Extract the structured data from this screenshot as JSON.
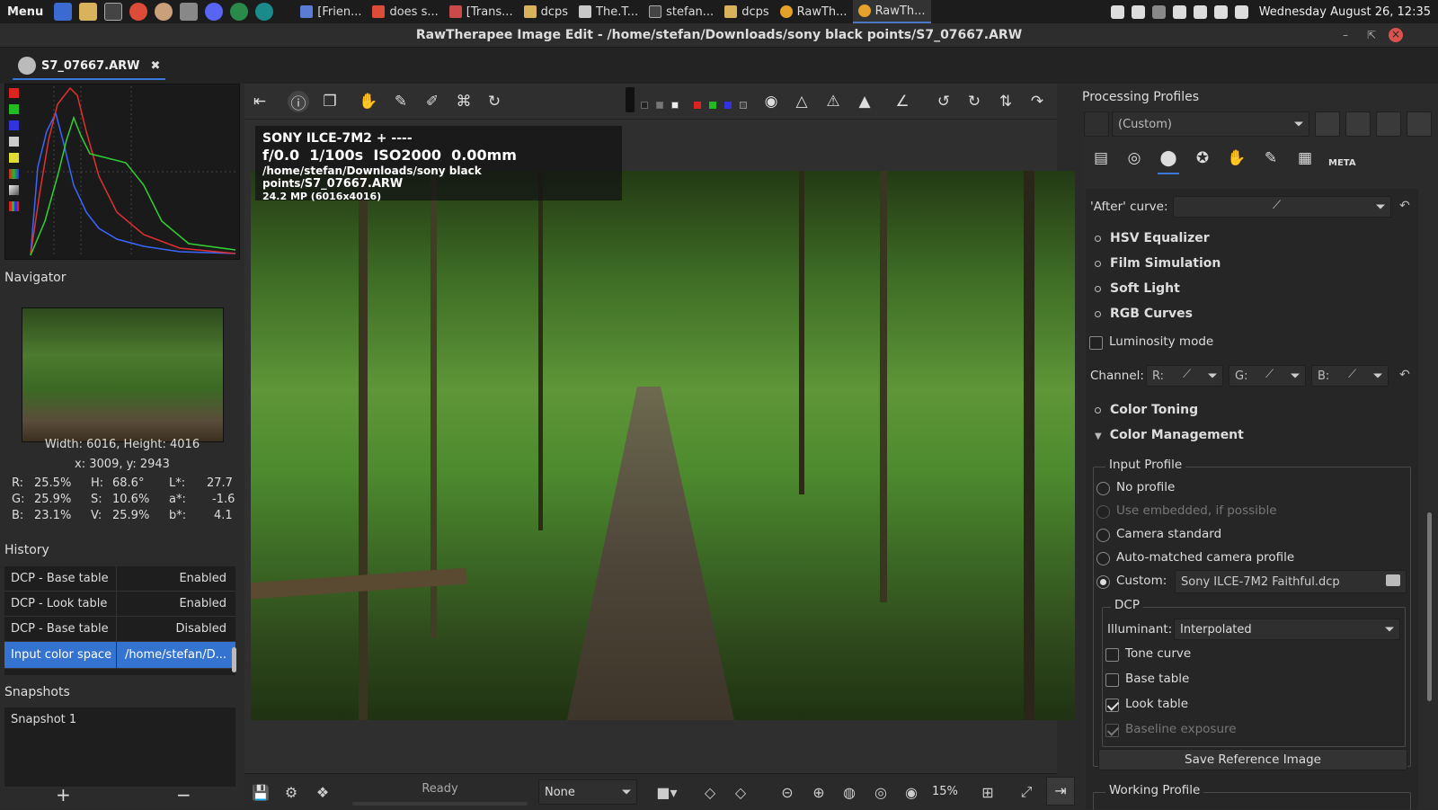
{
  "taskbar": {
    "menu_label": "Menu",
    "windows": [
      {
        "label": "[Frien...",
        "color": "#5b7bd5"
      },
      {
        "label": "does s...",
        "color": "#dd4b39"
      },
      {
        "label": "[Trans...",
        "color": "#c94a4a"
      },
      {
        "label": "dcps",
        "color": "#d9b35b"
      },
      {
        "label": "The.T...",
        "color": "#c9c9c9"
      },
      {
        "label": "stefan...",
        "color": "#444444"
      },
      {
        "label": "dcps",
        "color": "#d9b35b"
      },
      {
        "label": "RawTh...",
        "color": "#e5a22a"
      },
      {
        "label": "RawTh...",
        "color": "#e5a22a"
      }
    ],
    "clock": "Wednesday August 26, 12:35"
  },
  "window": {
    "title": "RawTherapee Image Edit - /home/stefan/Downloads/sony black points/S7_07667.ARW"
  },
  "editor_tab": {
    "label": "S7_07667.ARW"
  },
  "left": {
    "navigator_title": "Navigator",
    "size_text": "Width: 6016, Height: 4016",
    "coord_text": "x: 3009, y: 2943",
    "pixel": {
      "r": "R:",
      "r_val": "25.5%",
      "h": "H:",
      "h_val": "68.6°",
      "l": "L*:",
      "l_val": "27.7",
      "g": "G:",
      "g_val": "25.9%",
      "s": "S:",
      "s_val": "10.6%",
      "a": "a*:",
      "a_val": "-1.6",
      "b": "B:",
      "b_val": "23.1%",
      "v": "V:",
      "v_val": "25.9%",
      "bs": "b*:",
      "bs_val": "4.1"
    },
    "history_title": "History",
    "history": [
      {
        "action": "DCP - Base table",
        "value": "Enabled"
      },
      {
        "action": "DCP - Look table",
        "value": "Enabled"
      },
      {
        "action": "DCP - Base table",
        "value": "Disabled"
      },
      {
        "action": "Input color space",
        "value": "/home/stefan/D..."
      }
    ],
    "snapshots_title": "Snapshots",
    "snapshots": [
      "Snapshot 1"
    ],
    "add_label": "+",
    "remove_label": "−"
  },
  "info": {
    "line1": "SONY ILCE-7M2 + ----",
    "fnum": "f/0.0",
    "shutter": "1/100s",
    "iso": "ISO2000",
    "focal": "0.00mm",
    "path": "/home/stefan/Downloads/sony black points/",
    "file": "S7_07667.ARW",
    "mp": "24.2 MP (6016x4016)"
  },
  "bottom": {
    "status": "Ready",
    "mode_select": "None",
    "zoom": "15%"
  },
  "right": {
    "profiles_title": "Processing Profiles",
    "profile_value": "(Custom)",
    "after_curve_label": "'After' curve:",
    "sections": {
      "hsv": "HSV Equalizer",
      "film": "Film Simulation",
      "soft": "Soft Light",
      "rgb": "RGB Curves",
      "toning": "Color Toning",
      "cm": "Color Management",
      "working": "Working Profile"
    },
    "luminosity_label": "Luminosity mode",
    "channel_label": "Channel:",
    "ch_r": "R:",
    "ch_g": "G:",
    "ch_b": "B:",
    "input_profile_title": "Input Profile",
    "radios": {
      "no_profile": "No profile",
      "embedded": "Use embedded, if possible",
      "camera": "Camera standard",
      "auto": "Auto-matched camera profile",
      "custom": "Custom:"
    },
    "custom_file": "Sony ILCE-7M2 Faithful.dcp",
    "dcp_title": "DCP",
    "illuminant_label": "Illuminant:",
    "illuminant_value": "Interpolated",
    "checks": {
      "tone": "Tone curve",
      "base": "Base table",
      "look": "Look table",
      "baseline": "Baseline exposure"
    },
    "save_ref": "Save Reference Image",
    "meta_tab": "META"
  }
}
